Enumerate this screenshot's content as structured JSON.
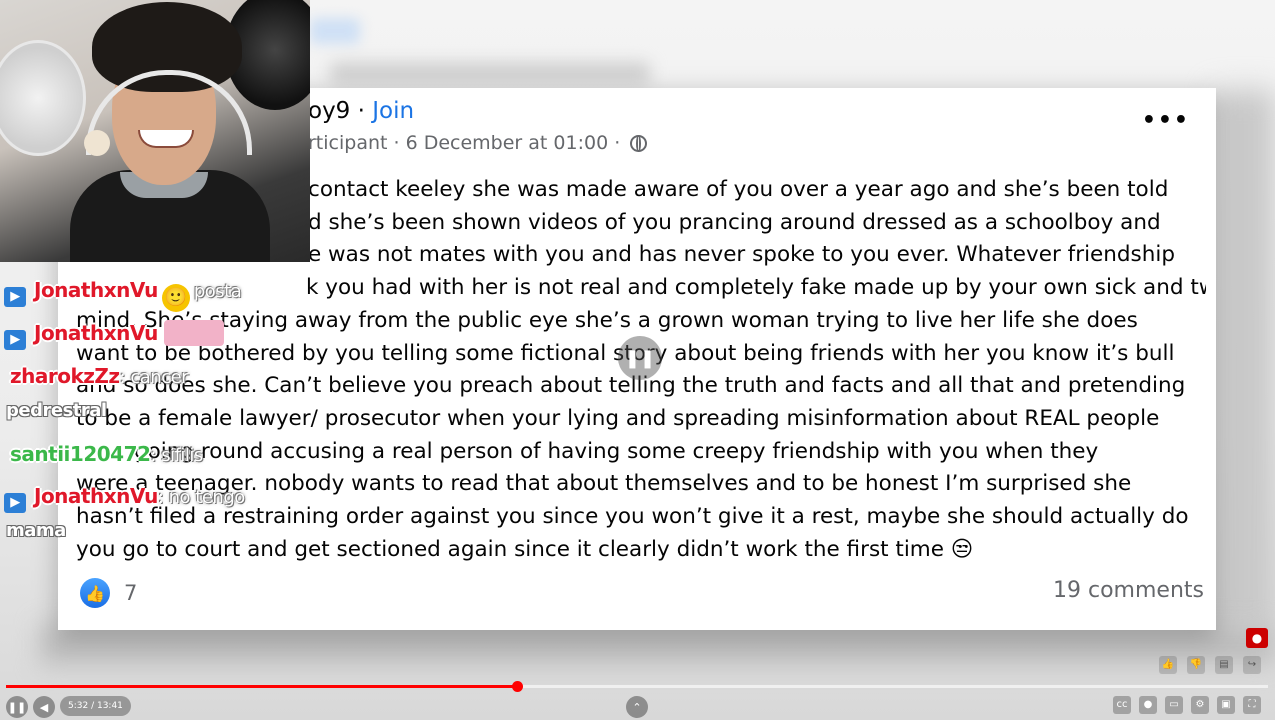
{
  "post": {
    "author_fragment": "oy9",
    "join_label": "Join",
    "meta_fragment": "rticipant · 6 December at 01:00 ·",
    "more_label": "•••",
    "lines": [
      "contact keeley she was made aware of you over a year ago and she’s been told",
      "d she’s been shown videos of you prancing around dressed as a schoolboy and",
      "e was not mates with you and has never spoke to you ever. Whatever friendship",
      "k you had with her is not real and completely fake made up by your own sick and twisted little",
      "mind. She’s staying away from the public eye she’s a grown woman trying to live her life she does",
      "want to be bothered by you telling some fictional story about being friends with her you know it’s bull",
      "and so does she. Can’t believe you preach about telling the truth and facts and all that and pretending",
      "to be a female lawyer/ prosecutor when your lying and spreading misinformation about REAL people",
      "going round accusing a real person of having some creepy friendship with you when they",
      "were a teenager. nobody wants to read that about themselves and to be honest I’m surprised she",
      "hasn’t filed a restraining order against you since you won’t give it a rest, maybe she should actually do",
      "you go to court and get sectioned again since it clearly didn’t work the first time 😒"
    ],
    "like_count": "7",
    "comments_label": "19 comments"
  },
  "chat": [
    {
      "user": "JonathxnVu",
      "text": "posta",
      "color": "#e0182a",
      "emoji": "🙂"
    },
    {
      "user": "JonathxnVu",
      "text": "",
      "color": "#e0182a"
    },
    {
      "user": "zharokzZz",
      "text": ": cancer",
      "color": "#e0182a"
    },
    {
      "plain": "pedrestral"
    },
    {
      "user": "santii120472",
      "text": ": sifilis",
      "color": "#3bb84a"
    },
    {
      "user": "JonathxnVu",
      "text": ": no tengo",
      "color": "#e0182a"
    },
    {
      "plain": "mama"
    }
  ],
  "player": {
    "time_label": "5:32 / 13:41",
    "progress": 0.405,
    "accent": "#ff0000"
  },
  "colors": {
    "link": "#1b74e4",
    "secondary_text": "#65676b"
  }
}
